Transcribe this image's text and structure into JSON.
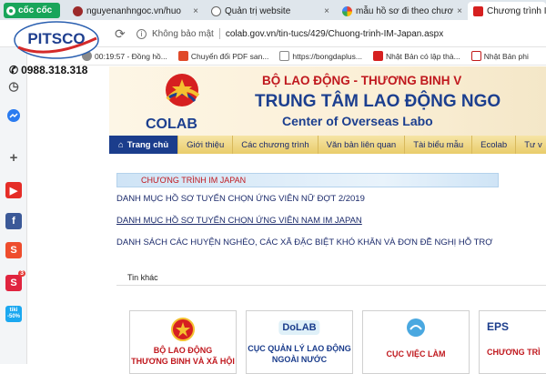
{
  "tabs": [
    {
      "label": "nguyenanhngoc.vn/huo",
      "close": "×"
    },
    {
      "label": "Quản trị website",
      "close": "×"
    },
    {
      "label": "mẫu hồ sơ đi theo chươ",
      "close": "×"
    },
    {
      "label": "Chương trình IM",
      "close": ""
    }
  ],
  "browser": {
    "brand": "cốc cốc",
    "security": "Không bảo mật",
    "url": "colab.gov.vn/tin-tucs/429/Chuong-trinh-IM-Japan.aspx"
  },
  "bookmarks": [
    {
      "label": "00:19:57 - Đồng hồ...",
      "icon": "clock-icon",
      "color": "#8a8a8a"
    },
    {
      "label": "Chuyển đổi PDF san...",
      "icon": "pdf-icon",
      "color": "#e04a2a"
    },
    {
      "label": "https://bongdaplus...",
      "icon": "page-icon",
      "color": "#777777"
    },
    {
      "label": "Nhật Bản có lập thà...",
      "icon": "sc-icon",
      "color": "#d62020"
    },
    {
      "label": "Nhật Bản phi",
      "icon": "page-icon",
      "color": "#c21a1a"
    }
  ],
  "overlay": {
    "logo": "PITSCO",
    "phone": "0988.318.318"
  },
  "sidebar": {
    "badge": "3",
    "tiki": "tiki\n-50%"
  },
  "header": {
    "logo_text": "COLAB",
    "ministry": "BỘ LAO ĐỘNG - THƯƠNG BINH V",
    "center": "TRUNG TÂM LAO ĐỘNG NGO",
    "english": "Center of Overseas Labo"
  },
  "menu": [
    "Trang chủ",
    "Giới thiệu",
    "Các chương trình",
    "Văn bản liên quan",
    "Tài biểu mẫu",
    "Ecolab",
    "Tư v"
  ],
  "content": {
    "section_title": "CHƯƠNG TRÌNH IM JAPAN",
    "links": [
      "DANH MỤC HỒ SƠ TUYỂN CHỌN ỨNG VIÊN NỮ ĐỢT 2/2019",
      "DANH MỤC HỒ SƠ TUYỂN CHỌN ỨNG VIÊN NAM IM JAPAN",
      "DANH SÁCH CÁC HUYỆN NGHÈO, CÁC XÃ ĐẶC BIỆT KHÓ KHĂN VÀ ĐƠN ĐỀ NGHỊ HỖ TRỢ"
    ],
    "others_label": "Tin khác"
  },
  "cards": [
    {
      "line1": "BỘ LAO ĐỘNG",
      "line2": "THƯƠNG BINH VÀ XÃ HỘI",
      "color": "#c0181e"
    },
    {
      "line1": "CỤC QUẢN LÝ LAO ĐỘNG",
      "line2": "NGOÀI NƯỚC",
      "color": "#1b3d8c",
      "logo": "DoLAB"
    },
    {
      "line1": "CỤC VIỆC LÀM",
      "line2": "",
      "color": "#c0181e"
    },
    {
      "line1": "CHƯƠNG TRÌ",
      "line2": "",
      "color": "#c0181e",
      "logo": "EPS"
    }
  ]
}
